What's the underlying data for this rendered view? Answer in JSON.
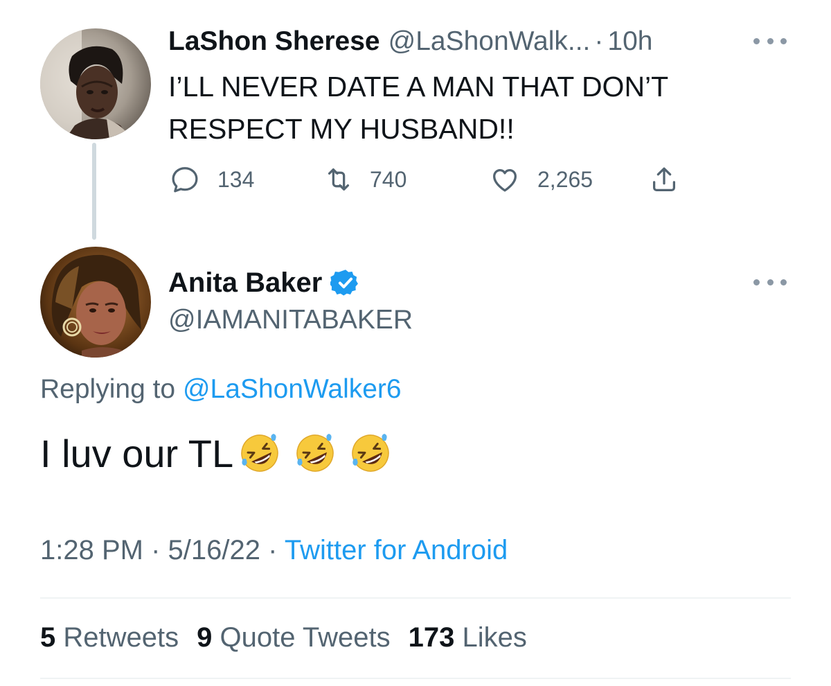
{
  "parent_tweet": {
    "author_name": "LaShon Sherese",
    "handle": "@LaShonWalk...",
    "separator": "·",
    "time": "10h",
    "text": "I’LL NEVER DATE A MAN THAT DON’T RESPECT MY HUSBAND!!",
    "actions": {
      "replies": "134",
      "retweets": "740",
      "likes": "2,265"
    },
    "avatar_icon": "user-photo-avatar"
  },
  "main_tweet": {
    "author_name": "Anita Baker",
    "handle": "@IAMANITABAKER",
    "verified": true,
    "replying_label": "Replying to",
    "replying_handle": "@LaShonWalker6",
    "text": "I luv our TL",
    "emojis": [
      "rolling-on-floor-laughing",
      "rolling-on-floor-laughing",
      "rolling-on-floor-laughing"
    ],
    "time": "1:28 PM",
    "date": "5/16/22",
    "separator": "·",
    "source": "Twitter for Android",
    "stats": {
      "retweets_count": "5",
      "retweets_label": "Retweets",
      "quotes_count": "9",
      "quotes_label": "Quote Tweets",
      "likes_count": "173",
      "likes_label": "Likes"
    }
  },
  "colors": {
    "text_primary": "#0f1419",
    "text_secondary": "#536471",
    "accent": "#1d9bf0",
    "divider": "#eff3f4",
    "thread_line": "#cfd9de"
  }
}
